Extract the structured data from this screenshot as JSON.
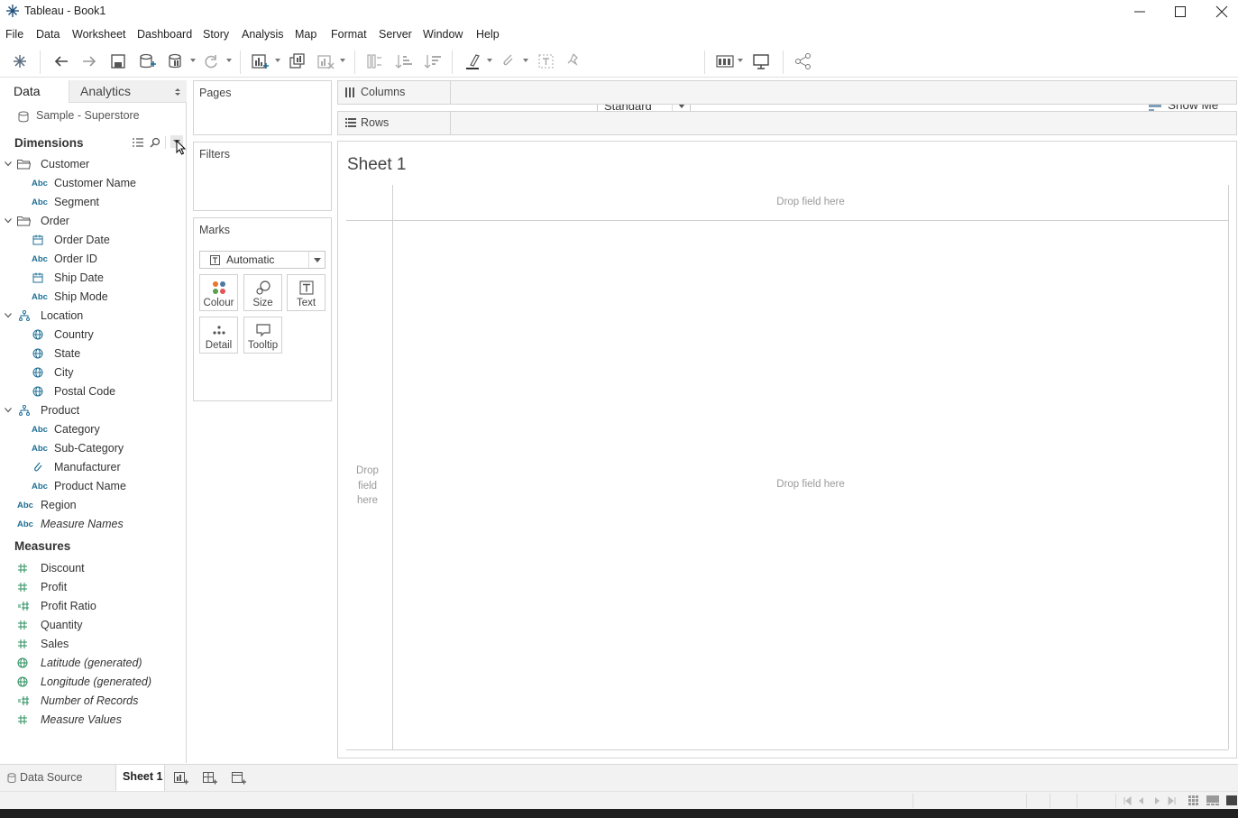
{
  "window": {
    "title": "Tableau - Book1"
  },
  "menu": [
    "File",
    "Data",
    "Worksheet",
    "Dashboard",
    "Story",
    "Analysis",
    "Map",
    "Format",
    "Server",
    "Window",
    "Help"
  ],
  "toolbar": {
    "fit_select": "Standard",
    "show_me": "Show Me"
  },
  "data_pane": {
    "tab_data": "Data",
    "tab_analytics": "Analytics",
    "datasource": "Sample - Superstore",
    "dimensions_header": "Dimensions",
    "measures_header": "Measures",
    "dimensions": [
      {
        "label": "Customer",
        "type": "folder",
        "level": 0
      },
      {
        "label": "Customer Name",
        "type": "abc",
        "level": 1
      },
      {
        "label": "Segment",
        "type": "abc",
        "level": 1
      },
      {
        "label": "Order",
        "type": "folder",
        "level": 0
      },
      {
        "label": "Order Date",
        "type": "date",
        "level": 1
      },
      {
        "label": "Order ID",
        "type": "abc",
        "level": 1
      },
      {
        "label": "Ship Date",
        "type": "date",
        "level": 1
      },
      {
        "label": "Ship Mode",
        "type": "abc",
        "level": 1
      },
      {
        "label": "Location",
        "type": "hierarchy",
        "level": 0
      },
      {
        "label": "Country",
        "type": "geo",
        "level": 1
      },
      {
        "label": "State",
        "type": "geo",
        "level": 1
      },
      {
        "label": "City",
        "type": "geo",
        "level": 1
      },
      {
        "label": "Postal Code",
        "type": "geo",
        "level": 1
      },
      {
        "label": "Product",
        "type": "hierarchy",
        "level": 0
      },
      {
        "label": "Category",
        "type": "abc",
        "level": 1
      },
      {
        "label": "Sub-Category",
        "type": "abc",
        "level": 1
      },
      {
        "label": "Manufacturer",
        "type": "group",
        "level": 1
      },
      {
        "label": "Product Name",
        "type": "abc",
        "level": 1
      },
      {
        "label": "Region",
        "type": "abc",
        "level": 0
      },
      {
        "label": "Measure Names",
        "type": "abc",
        "level": 0,
        "italic": true
      }
    ],
    "measures": [
      {
        "label": "Discount",
        "type": "num"
      },
      {
        "label": "Profit",
        "type": "num"
      },
      {
        "label": "Profit Ratio",
        "type": "calc"
      },
      {
        "label": "Quantity",
        "type": "num"
      },
      {
        "label": "Sales",
        "type": "num"
      },
      {
        "label": "Latitude (generated)",
        "type": "geo",
        "italic": true
      },
      {
        "label": "Longitude (generated)",
        "type": "geo",
        "italic": true
      },
      {
        "label": "Number of Records",
        "type": "calc",
        "italic": true
      },
      {
        "label": "Measure Values",
        "type": "num",
        "italic": true
      }
    ]
  },
  "cards": {
    "pages": "Pages",
    "filters": "Filters",
    "marks": "Marks",
    "mark_type": "Automatic",
    "buttons": {
      "colour": "Colour",
      "size": "Size",
      "text": "Text",
      "detail": "Detail",
      "tooltip": "Tooltip"
    }
  },
  "shelves": {
    "columns": "Columns",
    "rows": "Rows"
  },
  "sheet": {
    "title": "Sheet 1",
    "drop_top": "Drop field here",
    "drop_center": "Drop field here",
    "drop_left_1": "Drop",
    "drop_left_2": "field",
    "drop_left_3": "here"
  },
  "bottom_tabs": {
    "data_source": "Data Source",
    "sheet1": "Sheet 1"
  },
  "colors": {
    "dimension_icon": "#1f6f95",
    "measure_icon": "#2a8e5c",
    "accent": "#1f6f95"
  }
}
